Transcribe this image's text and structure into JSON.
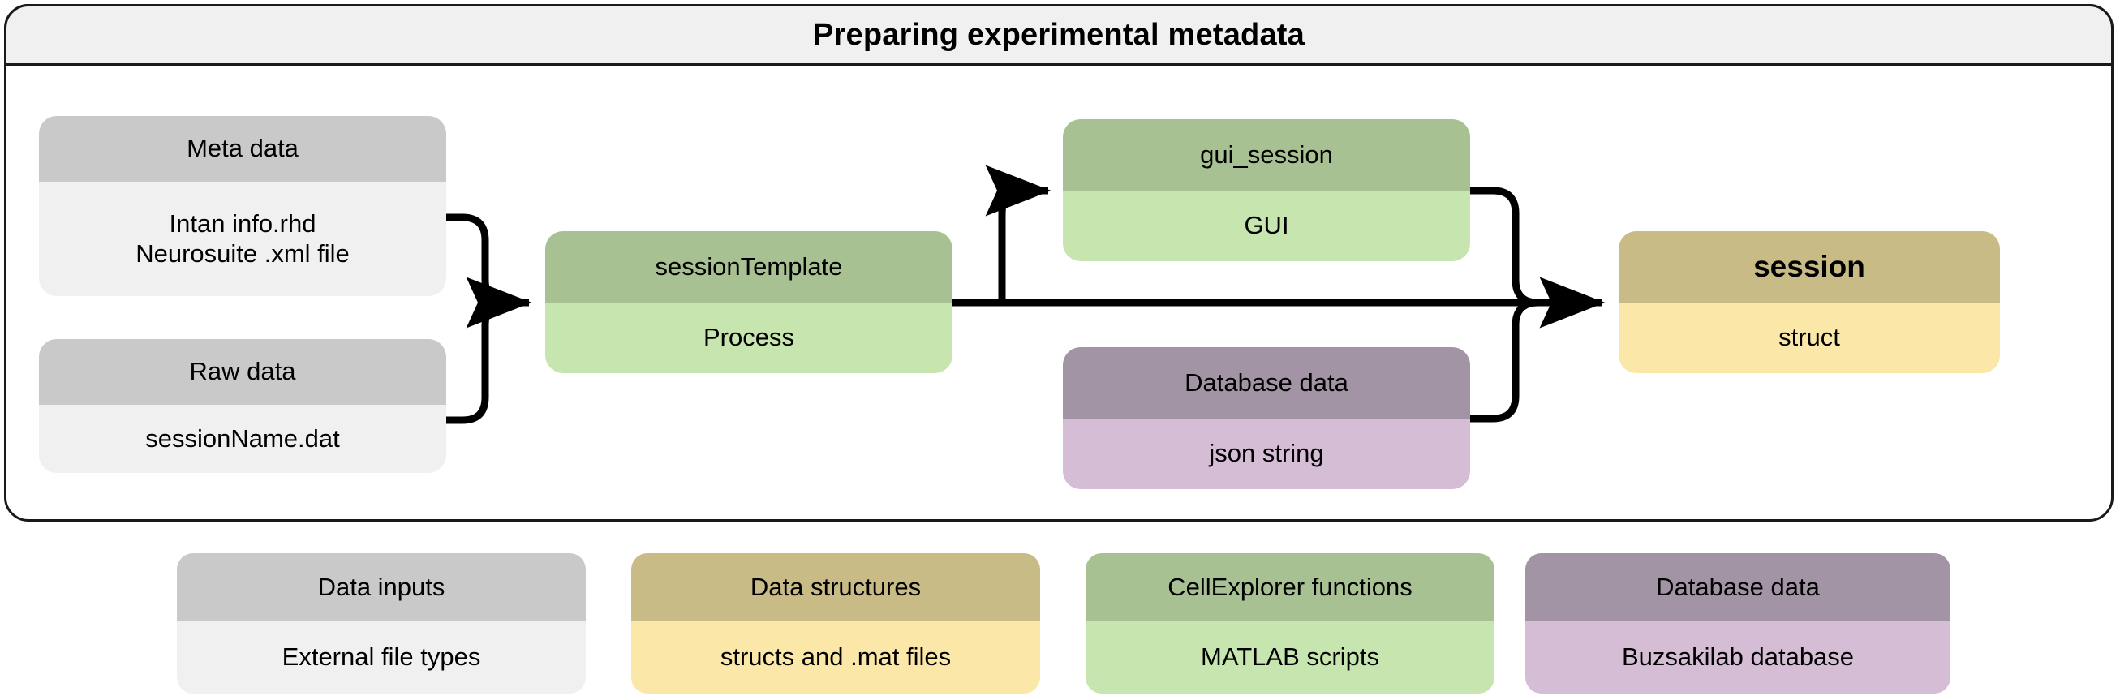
{
  "frame": {
    "title": "Preparing experimental metadata"
  },
  "nodes": {
    "metadata": {
      "title": "Meta data",
      "subtitle": "Intan info.rhd\nNeurosuite .xml file"
    },
    "rawdata": {
      "title": "Raw data",
      "subtitle": "sessionName.dat"
    },
    "sessiontemplate": {
      "title": "sessionTemplate",
      "subtitle": "Process"
    },
    "guisession": {
      "title": "gui_session",
      "subtitle": "GUI"
    },
    "databasedata": {
      "title": "Database data",
      "subtitle": "json string"
    },
    "session": {
      "title": "session",
      "subtitle": "struct"
    }
  },
  "legend": {
    "items": [
      {
        "title": "Data inputs",
        "subtitle": "External file types"
      },
      {
        "title": "Data structures",
        "subtitle": "structs and .mat files"
      },
      {
        "title": "CellExplorer functions",
        "subtitle": "MATLAB scripts"
      },
      {
        "title": "Database data",
        "subtitle": "Buzsakilab database"
      }
    ]
  },
  "colors": {
    "data_inputs_header": "#c9c9c9",
    "data_inputs_body": "#f0f0f0",
    "data_structures_header": "#c9bb86",
    "data_structures_body": "#fbe7a7",
    "cellexplorer_header": "#a8c193",
    "cellexplorer_body": "#c7e5ae",
    "database_header": "#a294a4",
    "database_body": "#d5bdd6",
    "frame_border": "#1a1a1a",
    "frame_title_bg": "#f0f0f0",
    "connector": "#000000",
    "canvas": "#ffffff"
  },
  "connectors": [
    {
      "from": "metadata",
      "to": "sessiontemplate",
      "style": "elbow-merge"
    },
    {
      "from": "rawdata",
      "to": "sessiontemplate",
      "style": "elbow-merge"
    },
    {
      "from": "sessiontemplate",
      "to": "guisession",
      "style": "elbow-up"
    },
    {
      "from": "sessiontemplate",
      "to": "session",
      "style": "straight"
    },
    {
      "from": "guisession",
      "to": "session",
      "style": "elbow-merge"
    },
    {
      "from": "databasedata",
      "to": "session",
      "style": "elbow-merge"
    }
  ]
}
